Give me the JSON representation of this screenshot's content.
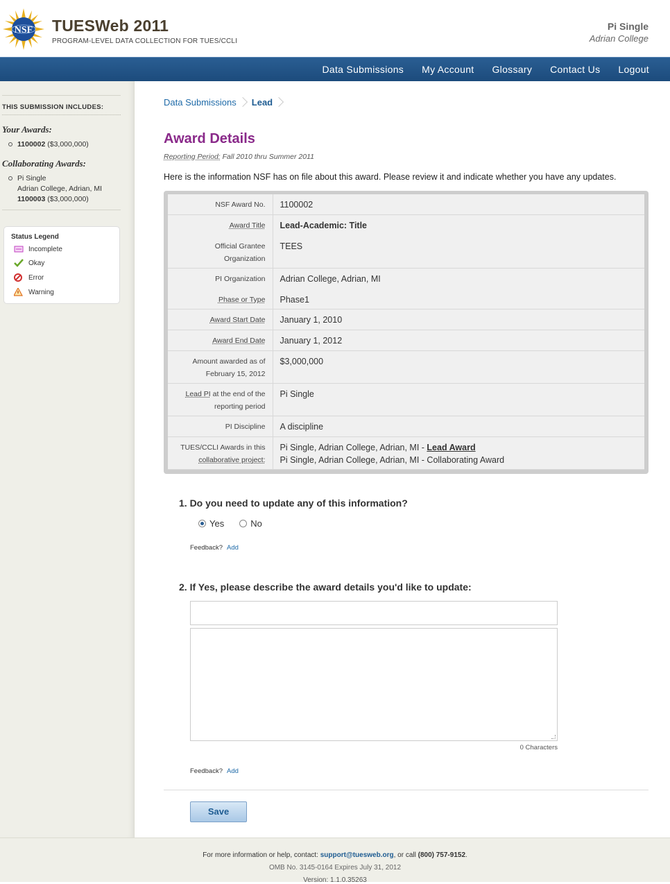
{
  "header": {
    "app_title": "TUESWeb 2011",
    "app_subtitle": "PROGRAM-LEVEL DATA COLLECTION FOR TUES/CCLI",
    "logo_text": "NSF",
    "user_name": "Pi Single",
    "user_org": "Adrian College"
  },
  "nav": {
    "items": [
      "Data Submissions",
      "My Account",
      "Glossary",
      "Contact Us",
      "Logout"
    ]
  },
  "sidebar": {
    "heading": "THIS SUBMISSION INCLUDES:",
    "your_awards_title": "Your Awards:",
    "your_awards": [
      {
        "number": "1100002",
        "amount": "($3,000,000)"
      }
    ],
    "collab_title": "Collaborating Awards:",
    "collab_awards": [
      {
        "name": "Pi Single",
        "org": "Adrian College, Adrian, MI",
        "number": "1100003",
        "amount": "($3,000,000)"
      }
    ],
    "legend": {
      "title": "Status Legend",
      "items": [
        {
          "label": "Incomplete",
          "icon": "incomplete-icon",
          "color": "#c040c0"
        },
        {
          "label": "Okay",
          "icon": "checkmark-icon",
          "color": "#6aa82a"
        },
        {
          "label": "Error",
          "icon": "error-icon",
          "color": "#d03030"
        },
        {
          "label": "Warning",
          "icon": "warning-icon",
          "color": "#e0a020"
        }
      ]
    }
  },
  "breadcrumb": {
    "items": [
      "Data Submissions",
      "Lead"
    ]
  },
  "page": {
    "title": "Award Details",
    "reporting_label": "Reporting Period:",
    "reporting_value": "Fall 2010 thru Summer 2011",
    "intro": "Here is the information NSF has on file about this award. Please review it and indicate whether you have any updates."
  },
  "details": {
    "award_no_label": "NSF Award No.",
    "award_no": "1100002",
    "award_title_label": "Award Title",
    "award_title": "Lead-Academic: Title",
    "grantee_label": "Official Grantee Organization",
    "grantee": "TEES",
    "pi_org_label": "PI Organization",
    "pi_org": "Adrian College, Adrian, MI",
    "phase_label": "Phase or Type",
    "phase": "Phase1",
    "start_label": "Award Start Date",
    "start": "January 1, 2010",
    "end_label": "Award End Date",
    "end": "January 1, 2012",
    "amount_label": "Amount awarded as of February 15, 2012",
    "amount": "$3,000,000",
    "lead_pi_label_abbr": "Lead PI",
    "lead_pi_label_rest": " at the end of the reporting period",
    "lead_pi": "Pi Single",
    "discipline_label": "PI Discipline",
    "discipline": "A discipline",
    "collab_label_line1": "TUES/CCLI Awards in this",
    "collab_label_line2": "collaborative project:",
    "collab_row1_text": "Pi Single, Adrian College, Adrian, MI - ",
    "collab_row1_link": "Lead Award",
    "collab_row2_text": "Pi Single, Adrian College, Adrian, MI - Collaborating Award"
  },
  "questions": {
    "q1": "1. Do you need to update any of this information?",
    "q1_options": [
      "Yes",
      "No"
    ],
    "q1_selected": "Yes",
    "q2": "2. If Yes, please describe the award details you'd like to update:",
    "q2_input_value": "",
    "q2_textarea_value": "",
    "char_count": "0 Characters",
    "feedback_label": "Feedback?",
    "feedback_link": "Add"
  },
  "actions": {
    "save_label": "Save"
  },
  "footer": {
    "contact_prefix": "For more information or help, contact: ",
    "contact_email": "support@tuesweb.org",
    "contact_mid": ", or call ",
    "contact_phone": "(800) 757-9152",
    "contact_end": ".",
    "omb": "OMB No. 3145-0164 Expires July 31, 2012",
    "version": "Version: 1.1.0.35263"
  }
}
